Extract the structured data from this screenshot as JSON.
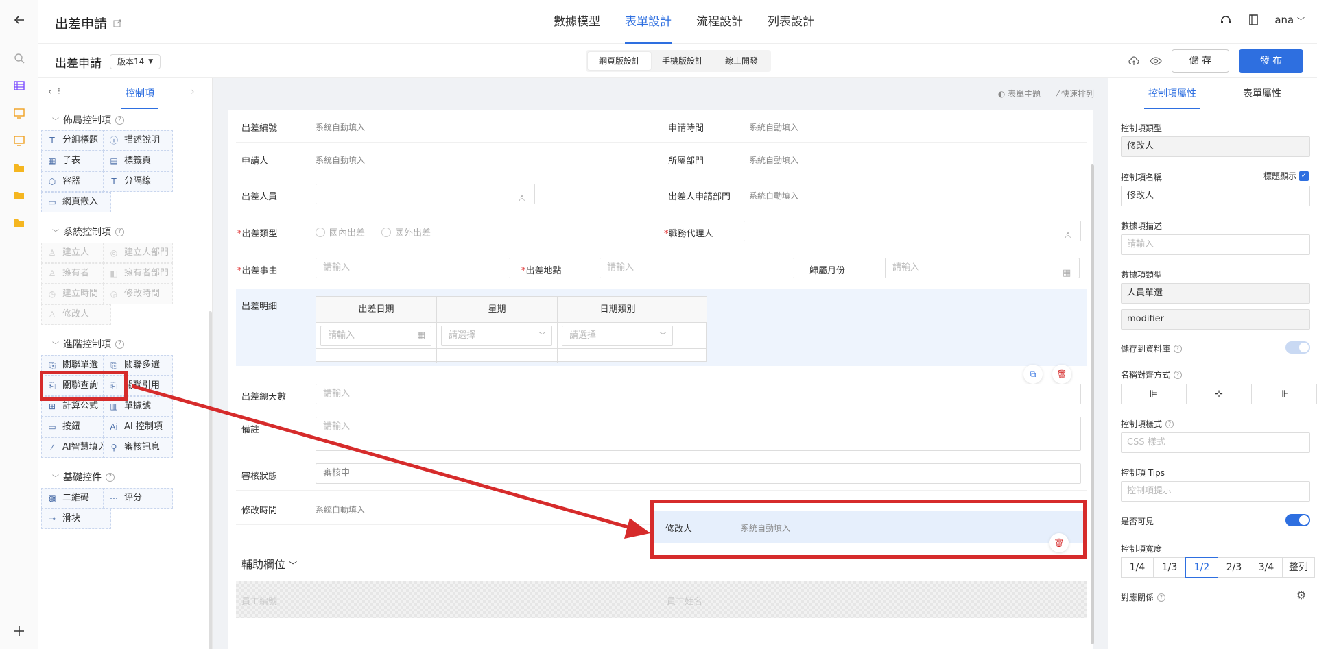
{
  "header": {
    "app_title": "出差申請",
    "tabs": [
      {
        "label": "數據模型"
      },
      {
        "label": "表單設計"
      },
      {
        "label": "流程設計"
      },
      {
        "label": "列表設計"
      }
    ],
    "user": "ana"
  },
  "subheader": {
    "form_name": "出差申請",
    "version": "版本14",
    "modes": [
      "網頁版設計",
      "手機版設計",
      "線上開發"
    ],
    "save_label": "儲 存",
    "publish_label": "發 布"
  },
  "left_panel": {
    "tab_label": "控制項",
    "sections": {
      "layout": "佈局控制項",
      "system": "系統控制項",
      "advanced": "進階控制項",
      "basic": "基礎控件"
    },
    "layout_items": [
      "分組標題",
      "描述說明",
      "子表",
      "標籤頁",
      "容器",
      "分隔線",
      "網頁嵌入"
    ],
    "system_items": [
      "建立人",
      "建立人部門",
      "擁有者",
      "擁有者部門",
      "建立時間",
      "修改時間",
      "修改人"
    ],
    "advanced_items": [
      "關聯單選",
      "關聯多選",
      "關聯查詢",
      "關聯引用",
      "計算公式",
      "單據號",
      "按鈕",
      "AI 控制項",
      "AI智慧填入",
      "審核訊息"
    ],
    "basic_items": [
      "二維码",
      "评分",
      "滑块"
    ]
  },
  "canvas": {
    "tools": [
      "表單主題",
      "快速排列"
    ],
    "auto_fill": "系統自動填入",
    "placeholder_input": "請輸入",
    "placeholder_select": "請選擇",
    "fields": {
      "trip_no": "出差編號",
      "apply_time": "申請時間",
      "applicant": "申請人",
      "dept": "所屬部門",
      "traveler": "出差人員",
      "traveler_dept": "出差人申請部門",
      "trip_type": "出差類型",
      "domestic": "國內出差",
      "abroad": "國外出差",
      "deputy": "職務代理人",
      "reason": "出差事由",
      "location": "出差地點",
      "month": "歸屬月份",
      "detail": "出差明細",
      "total_days": "出差總天數",
      "remark": "備註",
      "review_status": "審核狀態",
      "review_value": "審核中",
      "modify_time": "修改時間",
      "modifier": "修改人"
    },
    "subtable_headers": [
      "出差日期",
      "星期",
      "日期類別"
    ],
    "aux_title": "輔助欄位",
    "aux_fields": [
      "員工編號",
      "員工姓名"
    ]
  },
  "right_panel": {
    "tabs": [
      "控制項屬性",
      "表單屬性"
    ],
    "control_type_label": "控制項類型",
    "control_type_value": "修改人",
    "control_name_label": "控制項名稱",
    "title_show_label": "標題顯示",
    "control_name_value": "修改人",
    "data_desc_label": "數據項描述",
    "data_desc_placeholder": "請輸入",
    "data_type_label": "數據項類型",
    "data_type_value": "人員單選",
    "data_key_value": "modifier",
    "save_db_label": "儲存到資料庫",
    "align_label": "名稱對齊方式",
    "style_label": "控制項樣式",
    "style_placeholder": "CSS 樣式",
    "tips_label": "控制項 Tips",
    "tips_placeholder": "控制項提示",
    "visible_label": "是否可見",
    "width_label": "控制項寬度",
    "width_options": [
      "1/4",
      "1/3",
      "1/2",
      "2/3",
      "3/4",
      "整列"
    ],
    "width_selected": "1/2",
    "mapping_label": "對應關係"
  },
  "colors": {
    "accent": "#2e6fe0",
    "highlight": "#d62b2b"
  }
}
